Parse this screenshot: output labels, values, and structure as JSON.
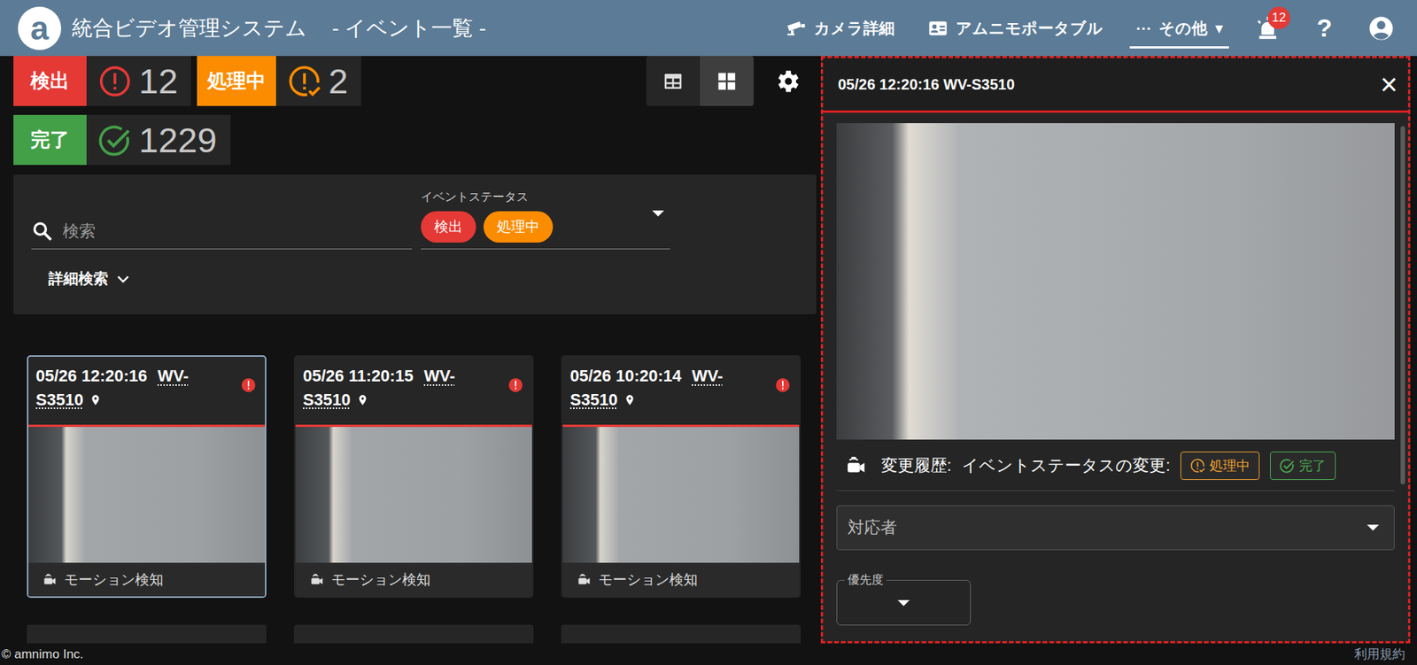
{
  "header": {
    "logo": "a",
    "title": "統合ビデオ管理システム",
    "subtitle": "- イベント一覧 -",
    "nav": [
      {
        "kind": "camera",
        "label": "カメラ詳細",
        "selected": false
      },
      {
        "kind": "portable",
        "label": "アムニモポータブル",
        "selected": false
      },
      {
        "kind": "more",
        "dots": "···",
        "label": "その他",
        "caret": "▾",
        "selected": true
      }
    ],
    "alerts_badge": "12",
    "help": "?"
  },
  "counters": [
    {
      "kind": "detected",
      "label": "検出",
      "count": "12",
      "color": "#e53935"
    },
    {
      "kind": "processing",
      "label": "処理中",
      "count": "2",
      "color": "#fb8c00"
    },
    {
      "kind": "done",
      "label": "完了",
      "count": "1229",
      "color": "#43a047"
    }
  ],
  "view_toggle": [
    {
      "kind": "table",
      "selected": false
    },
    {
      "kind": "grid",
      "selected": true
    }
  ],
  "search": {
    "placeholder": "検索",
    "status_label": "イベントステータス",
    "chips": [
      {
        "label": "検出",
        "color": "#e53935"
      },
      {
        "label": "処理中",
        "color": "#fb8c00"
      }
    ],
    "advanced": "詳細検索"
  },
  "events": [
    {
      "time": "05/26 12:20:16",
      "camera": "WV-S3510",
      "type": "モーション検知",
      "selected": true,
      "color": "#e53935"
    },
    {
      "time": "05/26 11:20:15",
      "camera": "WV-S3510",
      "type": "モーション検知",
      "selected": false,
      "color": "#e53935"
    },
    {
      "time": "05/26 10:20:14",
      "camera": "WV-S3510",
      "type": "モーション検知",
      "selected": false,
      "color": "#e53935"
    }
  ],
  "detail": {
    "title": "05/26 12:20:16 WV-S3510",
    "close": "×",
    "history_label": "変更履歴:",
    "status_change_label": "イベントステータスの変更:",
    "buttons": [
      {
        "kind": "processing",
        "label": "処理中",
        "color": "#f0a030"
      },
      {
        "kind": "done",
        "label": "完了",
        "color": "#4caf50"
      }
    ],
    "assignee": "対応者",
    "priority_label": "優先度"
  },
  "footer": {
    "copyright": "© amnimo Inc.",
    "terms": "利用規約"
  }
}
